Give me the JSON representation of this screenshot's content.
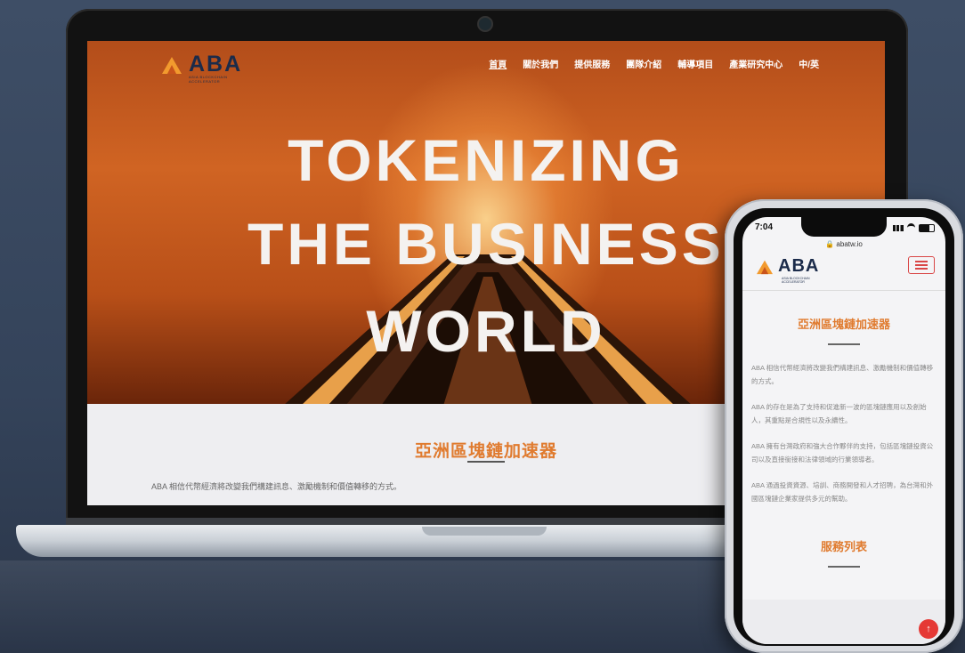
{
  "laptop": {
    "brand": "ABA",
    "brand_sub": "ASIA BLOCKCHAIN ACCELERATOR",
    "nav": [
      "首頁",
      "關於我們",
      "提供服務",
      "團隊介紹",
      "輔導項目",
      "產業研究中心",
      "中/英"
    ],
    "active_nav": "首頁",
    "hero_lines": [
      "TOKENIZING",
      "THE BUSINESS",
      "WORLD"
    ],
    "section_title": "亞洲區塊鏈加速器",
    "section_text": "ABA 相信代幣經濟將改變我們構建訊息、激勵機制和價值轉移的方式。"
  },
  "phone": {
    "time": "7:04",
    "url": "abatw.io",
    "brand": "ABA",
    "brand_sub": "ASIA BLOCKCHAIN ACCELERATOR",
    "section_title": "亞洲區塊鏈加速器",
    "paragraphs": [
      "ABA 相信代幣經濟將改變我們構建訊息、激勵機制和價值轉移的方式。",
      "ABA 的存在是為了支持和促進新一波的區塊鏈應用以及創始人，其重點是合規性以及永續性。",
      "ABA 擁有台灣政府和強大合作夥伴的支持，包括區塊鏈投資公司以及直接銜接和法律領域的行業領導者。",
      "ABA 通過投資資源、培訓、商務開發和人才招聘，為台灣和外國區塊鏈企業家提供多元的幫助。"
    ],
    "services_title": "服務列表",
    "fab_icon": "arrow-up-icon"
  },
  "colors": {
    "accent": "#e07b2f",
    "menu_red": "#d94646",
    "navy": "#1b2b4a"
  }
}
